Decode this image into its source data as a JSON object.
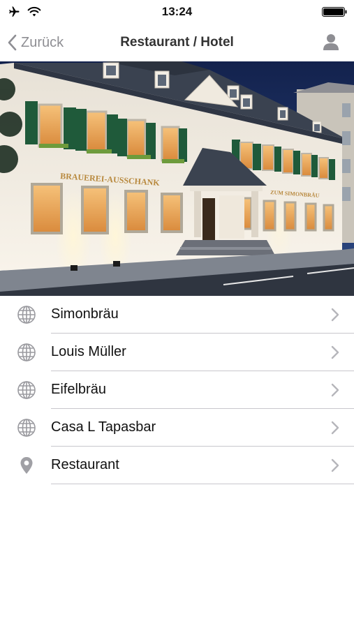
{
  "status_bar": {
    "time": "13:24"
  },
  "nav": {
    "back_label": "Zurück",
    "title": "Restaurant / Hotel"
  },
  "hero": {
    "sign_left": "BRAUEREI-AUSSCHANK",
    "sign_right": "ZUM SIMONBRÄU"
  },
  "list": {
    "items": [
      {
        "label": "Simonbräu",
        "icon": "globe-icon"
      },
      {
        "label": "Louis Müller",
        "icon": "globe-icon"
      },
      {
        "label": "Eifelbräu",
        "icon": "globe-icon"
      },
      {
        "label": "Casa L Tapasbar",
        "icon": "globe-icon"
      },
      {
        "label": "Restaurant",
        "icon": "location-pin-icon"
      }
    ]
  },
  "colors": {
    "accent_gray": "#8e8e93",
    "separator": "#c8c7cc",
    "shutter_green": "#1f5a3a",
    "facade": "#f1ece4",
    "roof": "#3a4250",
    "sky": "#1b2a55"
  }
}
